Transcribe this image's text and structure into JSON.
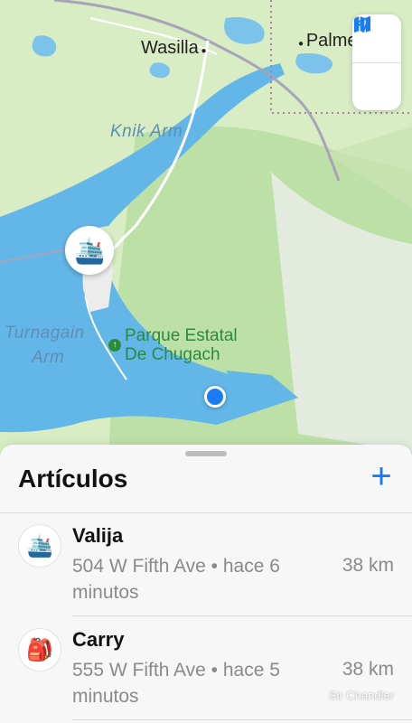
{
  "map": {
    "labels": {
      "wasilla": "Wasilla",
      "palmer": "Palme",
      "knik_arm": "Knik Arm",
      "turnagain_1": "Turnagain",
      "turnagain_2": "Arm",
      "park_1": "Parque Estatal",
      "park_2": "De Chugach"
    },
    "controls": {
      "map_icon": "map-icon",
      "location_icon": "location-arrow-icon"
    },
    "pin_emoji": "🛳️"
  },
  "sheet": {
    "title": "Artículos",
    "add_label": "+"
  },
  "items": [
    {
      "emoji": "🛳️",
      "name": "Valija",
      "address": "504 W Fifth Ave • hace 6 minutos",
      "distance": "38 km"
    },
    {
      "emoji": "🎒",
      "name": "Carry",
      "address": "555 W Fifth Ave • hace 5 minutos",
      "distance": "38 km"
    }
  ],
  "watermark": "Sir Chandler",
  "colors": {
    "accent": "#1a7cf5",
    "water": "#63b6e8",
    "land": "#d9edc8",
    "park_green": "#2c8a3f"
  }
}
